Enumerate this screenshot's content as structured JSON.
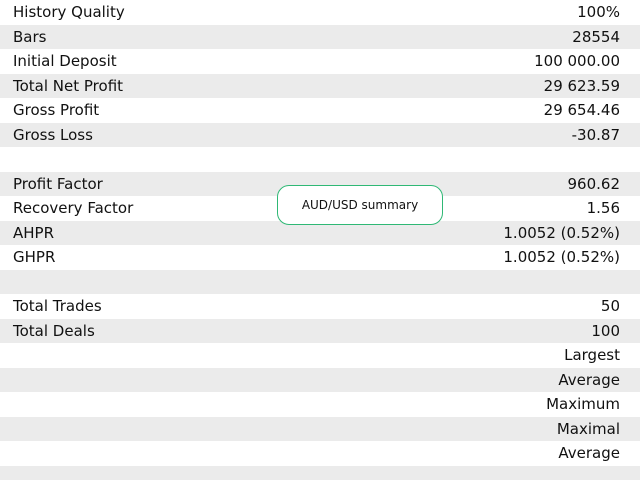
{
  "report": {
    "rows": [
      {
        "label": "History Quality",
        "value": "100%"
      },
      {
        "label": "Bars",
        "value": "28554"
      },
      {
        "label": "Initial Deposit",
        "value": "100 000.00"
      },
      {
        "label": "Total Net Profit",
        "value": "29 623.59"
      },
      {
        "label": "Gross Profit",
        "value": "29 654.46"
      },
      {
        "label": "Gross Loss",
        "value": "-30.87"
      },
      {
        "label": "",
        "value": ""
      },
      {
        "label": "Profit Factor",
        "value": "960.62"
      },
      {
        "label": "Recovery Factor",
        "value": "1.56"
      },
      {
        "label": "AHPR",
        "value": "1.0052 (0.52%)"
      },
      {
        "label": "GHPR",
        "value": "1.0052 (0.52%)"
      },
      {
        "label": "",
        "value": ""
      },
      {
        "label": "Total Trades",
        "value": "50"
      },
      {
        "label": "Total Deals",
        "value": "100"
      },
      {
        "label": "",
        "value": "Largest"
      },
      {
        "label": "",
        "value": "Average"
      },
      {
        "label": "",
        "value": "Maximum"
      },
      {
        "label": "",
        "value": "Maximal"
      },
      {
        "label": "",
        "value": "Average"
      },
      {
        "label": "",
        "value": ""
      }
    ]
  },
  "tooltip": {
    "text": "AUD/USD summary"
  },
  "colors": {
    "row_stripe": "#ebebeb",
    "tooltip_border": "#2fb875"
  }
}
